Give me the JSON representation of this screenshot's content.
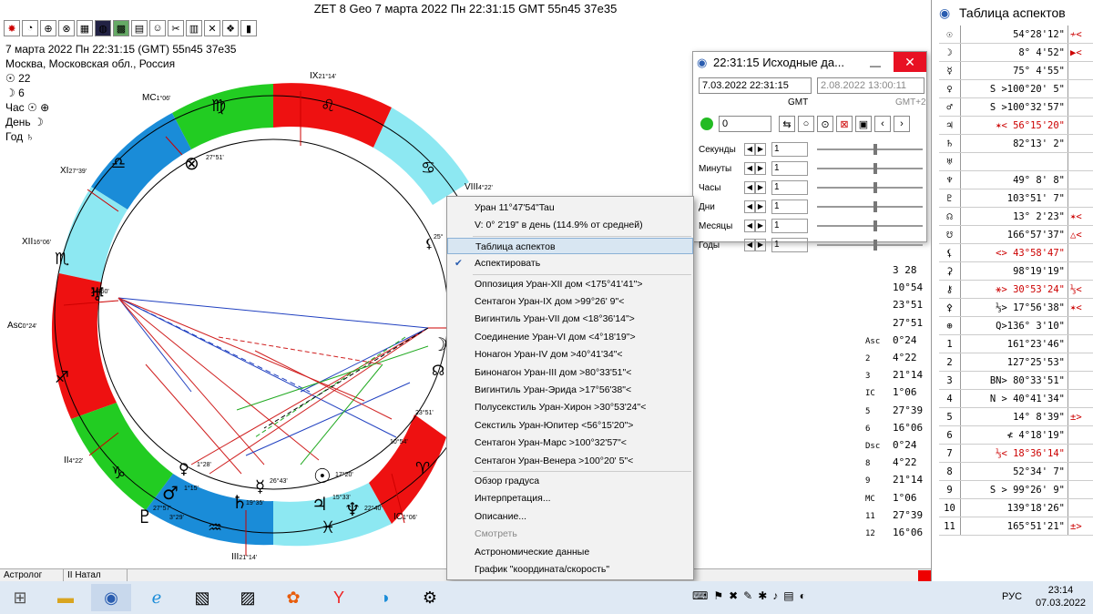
{
  "window_title": "ZET 8 Geo     7 марта 2022  Пн  22:31:15 GMT 55n45  37e35",
  "info": {
    "line1": "7 марта 2022  Пн  22:31:15 (GMT) 55n45  37e35",
    "line2": "Москва, Московская обл., Россия",
    "sun": "22",
    "moon": "6",
    "hour_label": "Час",
    "day_label": "День",
    "year_label": "Год"
  },
  "house_labels": {
    "ix": "IX",
    "ix_deg": "21°14'",
    "mc": "MC",
    "mc_deg": "1°06'",
    "xi": "XI",
    "xi_deg": "27°39'",
    "xii": "XII",
    "xii_deg": "16°06'",
    "asc": "Asc",
    "asc_deg": "0°24'",
    "ii": "II",
    "ii_deg": "4°22'",
    "iii": "III",
    "iii_deg": "21°14'",
    "ic": "IC",
    "ic_deg": "1°06'",
    "viii": "VIII",
    "viii_deg": "4°22'"
  },
  "planet_labels": {
    "p1": "27°51'",
    "p2": "24°50'",
    "p3": "25°",
    "p4": "23°51'",
    "p5": "10°54'",
    "p6": "1°28'",
    "p7": "1°15'",
    "p8": "26°43'",
    "p9": "17°20'",
    "p10": "27°57'",
    "p11": "3°29'",
    "p12": "19°35'",
    "p13": "15°33'",
    "p14": "22°40'"
  },
  "statusbar": {
    "left": "Астролог",
    "right": "II Натал"
  },
  "hdr": {
    "title": "22:31:15 Исходные да...",
    "date1": "7.03.2022    22:31:15",
    "date2": "2.08.2022    13:00:11",
    "gmt": "GMT",
    "gmt2": "GMT+2",
    "counter": "0",
    "rows": [
      {
        "label": "Секунды",
        "value": "1"
      },
      {
        "label": "Минуты",
        "value": "1"
      },
      {
        "label": "Часы",
        "value": "1"
      },
      {
        "label": "Дни",
        "value": "1"
      },
      {
        "label": "Месяцы",
        "value": "1"
      },
      {
        "label": "Годы",
        "value": "1"
      }
    ]
  },
  "menu": [
    {
      "label": "Уран  11°47'54\"Tau",
      "state": "normal"
    },
    {
      "label": "V:  0° 2'19\" в день  (114.9% от средней)",
      "state": "normal"
    },
    {
      "label": "Таблица аспектов",
      "state": "highlight"
    },
    {
      "label": "Аспектировать",
      "state": "checked"
    },
    {
      "label": "Оппозиция Уран-XII дом  <175°41'41\">",
      "state": "normal"
    },
    {
      "label": "Сентагон Уран-IX дом  >99°26' 9\"<",
      "state": "normal"
    },
    {
      "label": "Вигинтиль Уран-VII дом  <18°36'14\">",
      "state": "normal"
    },
    {
      "label": "Соединение Уран-VI дом  <4°18'19\">",
      "state": "normal"
    },
    {
      "label": "Нонагон Уран-IV дом  >40°41'34\"<",
      "state": "normal"
    },
    {
      "label": "Бинонагон Уран-III дом  >80°33'51\"<",
      "state": "normal"
    },
    {
      "label": "Вигинтиль Уран-Эрида  >17°56'38\"<",
      "state": "normal"
    },
    {
      "label": "Полусекстиль Уран-Хирон  >30°53'24\"<",
      "state": "normal"
    },
    {
      "label": "Секстиль Уран-Юпитер  <56°15'20\">",
      "state": "normal"
    },
    {
      "label": "Сентагон Уран-Марс  >100°32'57\"<",
      "state": "normal"
    },
    {
      "label": "Сентагон Уран-Венера  >100°20' 5\"<",
      "state": "normal"
    },
    {
      "label": "Обзор градуса",
      "state": "normal"
    },
    {
      "label": "Интерпретация...",
      "state": "normal"
    },
    {
      "label": "Описание...",
      "state": "normal"
    },
    {
      "label": "Смотреть",
      "state": "disabled"
    },
    {
      "label": "Астрономические данные",
      "state": "normal"
    },
    {
      "label": "График \"координата/скорость\"",
      "state": "normal"
    }
  ],
  "right_column": [
    {
      "sym": "",
      "val": "3 28"
    },
    {
      "sym": "",
      "val": "10°54"
    },
    {
      "sym": "",
      "val": "23°51"
    },
    {
      "sym": "",
      "val": "27°51"
    },
    {
      "sym": "Asc",
      "val": "0°24"
    },
    {
      "sym": "2",
      "val": "4°22"
    },
    {
      "sym": "3",
      "val": "21°14"
    },
    {
      "sym": "IC",
      "val": "1°06"
    },
    {
      "sym": "5",
      "val": "27°39"
    },
    {
      "sym": "6",
      "val": "16°06"
    },
    {
      "sym": "Dsc",
      "val": "0°24"
    },
    {
      "sym": "8",
      "val": "4°22"
    },
    {
      "sym": "9",
      "val": "21°14"
    },
    {
      "sym": "MC",
      "val": "1°06"
    },
    {
      "sym": "11",
      "val": "27°39"
    },
    {
      "sym": "12",
      "val": "16°06"
    }
  ],
  "aspect_table": {
    "title": "Таблица аспектов",
    "rows": [
      {
        "sym": "☉",
        "val": "54°28'12\"",
        "c3": "≁<"
      },
      {
        "sym": "☽",
        "val": "8° 4'52\"",
        "c3": "▶<"
      },
      {
        "sym": "☿",
        "val": "75° 4'55\"",
        "c3": ""
      },
      {
        "sym": "♀",
        "val": "S >100°20' 5\"",
        "c3": ""
      },
      {
        "sym": "♂",
        "val": "S >100°32'57\"",
        "c3": ""
      },
      {
        "sym": "♃",
        "val": "✶< 56°15'20\"",
        "c3": ""
      },
      {
        "sym": "♄",
        "val": "82°13' 2\"",
        "c3": ""
      },
      {
        "sym": "♅",
        "val": "",
        "c3": ""
      },
      {
        "sym": "♆",
        "val": "49° 8' 8\"",
        "c3": ""
      },
      {
        "sym": "♇",
        "val": "103°51' 7\"",
        "c3": ""
      },
      {
        "sym": "☊",
        "val": "13° 2'23\"",
        "c3": "✶<"
      },
      {
        "sym": "☋",
        "val": "166°57'37\"",
        "c3": "△<"
      },
      {
        "sym": "⚸",
        "val": "<> 43°58'47\"",
        "c3": ""
      },
      {
        "sym": "⚳",
        "val": "98°19'19\"",
        "c3": ""
      },
      {
        "sym": "⚷",
        "val": "⚹> 30°53'24\"",
        "c3": "⅓<"
      },
      {
        "sym": "⚴",
        "val": "⅓> 17°56'38\"",
        "c3": "✶<"
      },
      {
        "sym": "⊕",
        "val": "Q>136° 3'10\"",
        "c3": ""
      },
      {
        "sym": "1",
        "val": "161°23'46\"",
        "c3": ""
      },
      {
        "sym": "2",
        "val": "127°25'53\"",
        "c3": ""
      },
      {
        "sym": "3",
        "val": "BN> 80°33'51\"",
        "c3": ""
      },
      {
        "sym": "4",
        "val": "N > 40°41'34\"",
        "c3": ""
      },
      {
        "sym": "5",
        "val": "14° 8'39\"",
        "c3": "±>"
      },
      {
        "sym": "6",
        "val": "≮ 4°18'19\"",
        "c3": ""
      },
      {
        "sym": "7",
        "val": "⅓< 18°36'14\"",
        "c3": ""
      },
      {
        "sym": "8",
        "val": "52°34' 7\"",
        "c3": ""
      },
      {
        "sym": "9",
        "val": "S > 99°26' 9\"",
        "c3": ""
      },
      {
        "sym": "10",
        "val": "139°18'26\"",
        "c3": ""
      },
      {
        "sym": "11",
        "val": "165°51'21\"",
        "c3": "±>"
      }
    ]
  },
  "taskbar": {
    "lang": "РУС",
    "time": "23:14",
    "date": "07.03.2022"
  },
  "colors": {
    "fire": "#ee1111",
    "earth": "#22cc22",
    "air": "#1a8cd8",
    "water": "#8de8f2",
    "accent": "#2a5db0"
  }
}
